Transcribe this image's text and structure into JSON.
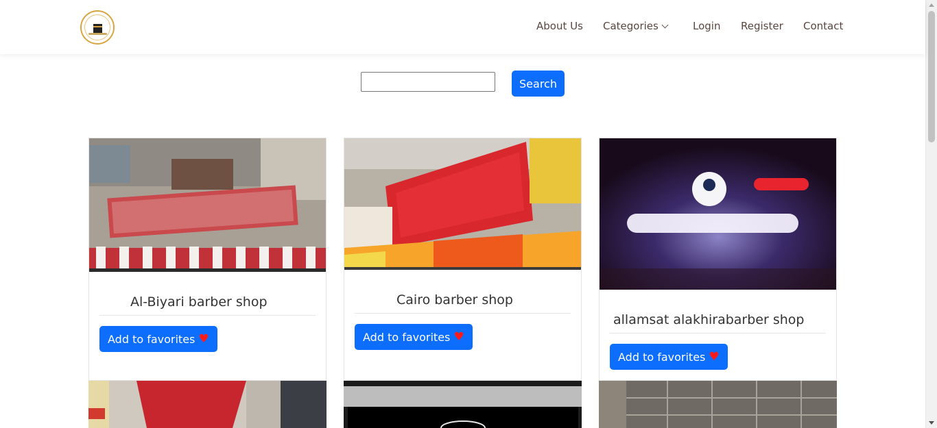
{
  "header": {
    "logo_icon": "kaaba-logo-icon",
    "nav": {
      "about": "About Us",
      "categories": "Categories",
      "login": "Login",
      "register": "Register",
      "contact": "Contact"
    }
  },
  "search": {
    "input_value": "",
    "button_label": "Search"
  },
  "cards": [
    {
      "title": "Al-Biyari barber shop",
      "button_label": "Add to favorites",
      "heart": "♥"
    },
    {
      "title": "Cairo barber shop",
      "button_label": "Add to favorites",
      "heart": "♥"
    },
    {
      "title": "allamsat alakhirabarber shop",
      "button_label": "Add to favorites",
      "heart": "♥"
    }
  ],
  "colors": {
    "primary": "#0d6efd",
    "heart": "#ff1a1a",
    "nav_text": "#5a4640"
  }
}
